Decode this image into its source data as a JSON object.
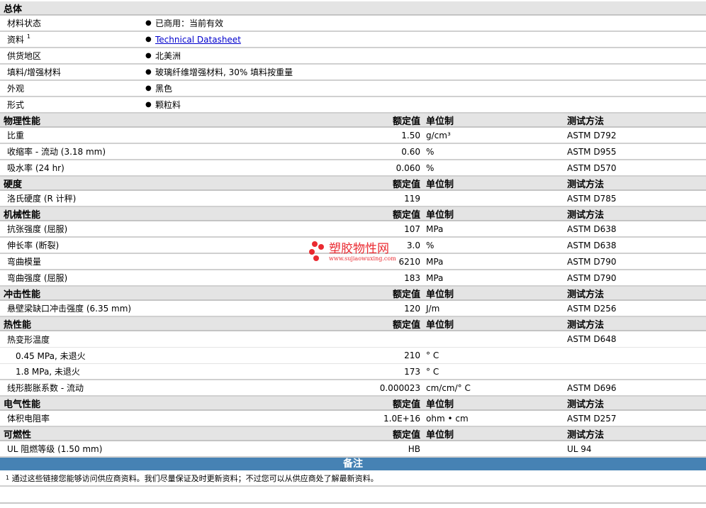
{
  "general": {
    "title": "总体",
    "rows": [
      {
        "label": "材料状态",
        "value": "已商用：当前有效"
      },
      {
        "label": "资料",
        "sup": "1",
        "value": "Technical Datasheet",
        "link": true
      },
      {
        "label": "供货地区",
        "value": "北美洲"
      },
      {
        "label": "填料/增强材料",
        "value": "玻璃纤维增强材料, 30% 填料按重量"
      },
      {
        "label": "外观",
        "value": "黑色"
      },
      {
        "label": "形式",
        "value": "颗粒料"
      }
    ]
  },
  "columns": {
    "value": "额定值",
    "unit": "单位制",
    "method": "测试方法"
  },
  "sections": [
    {
      "title": "物理性能",
      "rows": [
        {
          "name": "比重",
          "value": "1.50",
          "unit": "g/cm³",
          "method": "ASTM D792"
        },
        {
          "name": "收缩率  - 流动  (3.18 mm)",
          "value": "0.60",
          "unit": "%",
          "method": "ASTM D955"
        },
        {
          "name": "吸水率  (24 hr)",
          "value": "0.060",
          "unit": "%",
          "method": "ASTM D570"
        }
      ]
    },
    {
      "title": "硬度",
      "rows": [
        {
          "name": "洛氏硬度  (R 计秤)",
          "value": "119",
          "unit": "",
          "method": "ASTM D785"
        }
      ]
    },
    {
      "title": "机械性能",
      "rows": [
        {
          "name": "抗张强度  (屈服)",
          "value": "107",
          "unit": "MPa",
          "method": "ASTM D638"
        },
        {
          "name": "伸长率  (断裂)",
          "value": "3.0",
          "unit": "%",
          "method": "ASTM D638"
        },
        {
          "name": "弯曲模量",
          "value": "6210",
          "unit": "MPa",
          "method": "ASTM D790"
        },
        {
          "name": "弯曲强度  (屈服)",
          "value": "183",
          "unit": "MPa",
          "method": "ASTM D790"
        }
      ]
    },
    {
      "title": "冲击性能",
      "rows": [
        {
          "name": "悬壁梁缺口冲击强度  (6.35 mm)",
          "value": "120",
          "unit": "J/m",
          "method": "ASTM D256"
        }
      ]
    },
    {
      "title": "热性能",
      "rows": [
        {
          "name": "热变形温度",
          "value": "",
          "unit": "",
          "method": "ASTM D648",
          "thin": true
        },
        {
          "name": "0.45 MPa, 未退火",
          "value": "210",
          "unit": "° C",
          "method": "",
          "indent": true,
          "thin": true
        },
        {
          "name": "1.8 MPa, 未退火",
          "value": "173",
          "unit": "° C",
          "method": "",
          "indent": true
        },
        {
          "name": "线形膨胀系数  - 流动",
          "value": "0.000023",
          "unit": "cm/cm/° C",
          "method": "ASTM D696"
        }
      ]
    },
    {
      "title": "电气性能",
      "rows": [
        {
          "name": "体积电阻率",
          "value": "1.0E+16",
          "unit": "ohm • cm",
          "method": "ASTM D257"
        }
      ]
    },
    {
      "title": "可燃性",
      "rows": [
        {
          "name": "UL 阻燃等级  (1.50 mm)",
          "value": "HB",
          "unit": "",
          "method": "UL 94"
        }
      ]
    }
  ],
  "notes": {
    "title": "备注",
    "sup": "1",
    "text": "通过这些链接您能够访问供应商资料。我们尽量保证及时更新资料；不过您可以从供应商处了解最新资料。"
  },
  "watermark": {
    "name": "塑胶物性网",
    "url": "www.sujiaowuxing.com"
  }
}
